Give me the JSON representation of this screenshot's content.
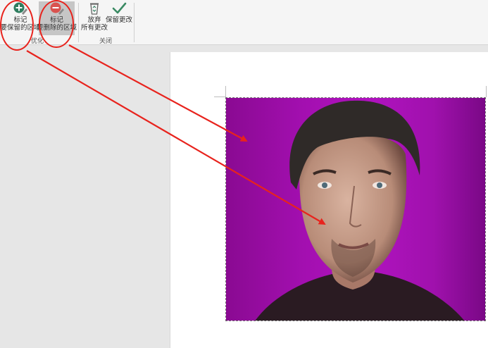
{
  "ribbon": {
    "refine_group": {
      "label": "优化",
      "keep_button": {
        "line1": "标记",
        "line2": "要保留的区域"
      },
      "delete_button": {
        "line1": "标记",
        "line2": "要删除的区域"
      }
    },
    "close_group": {
      "label": "关闭",
      "discard_button": {
        "line1": "放弃",
        "line2": "所有更改"
      },
      "save_button": {
        "line1": "保留更改"
      }
    }
  },
  "icons": {
    "keep": "plus-circle-pencil-icon",
    "delete": "minus-circle-pencil-icon",
    "discard": "recycle-bin-icon",
    "save": "checkmark-icon"
  },
  "colors": {
    "annotation_red": "#e8231d",
    "background_removal_magenta": "#a30fb0",
    "keep_icon": "#2f7d5f",
    "delete_icon": "#d9534f",
    "checkmark": "#3a8a63"
  }
}
